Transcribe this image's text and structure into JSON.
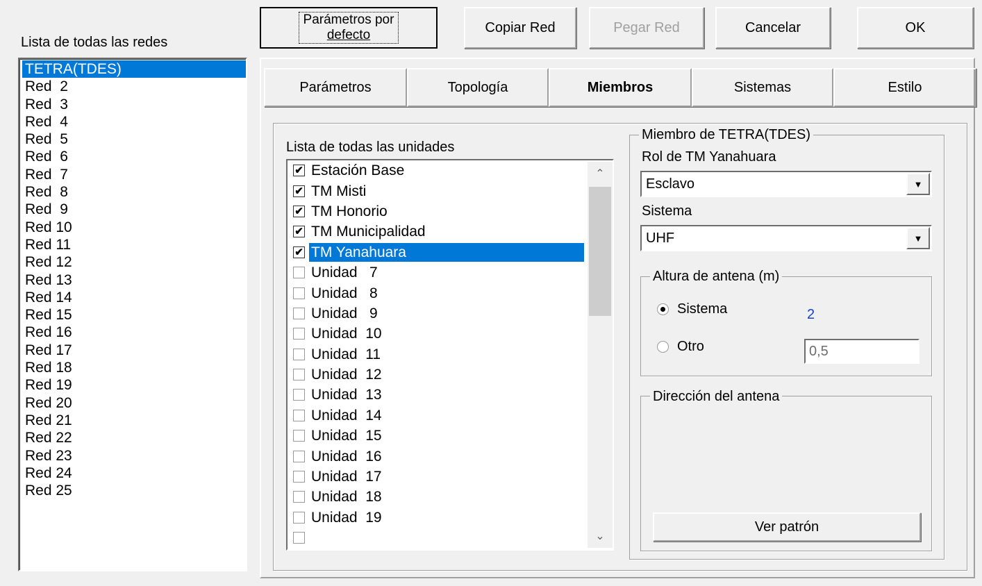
{
  "networks": {
    "label": "Lista de todas las redes",
    "items": [
      "TETRA(TDES)",
      "Red  2",
      "Red  3",
      "Red  4",
      "Red  5",
      "Red  6",
      "Red  7",
      "Red  8",
      "Red  9",
      "Red 10",
      "Red 11",
      "Red 12",
      "Red 13",
      "Red 14",
      "Red 15",
      "Red 16",
      "Red 17",
      "Red 18",
      "Red 19",
      "Red 20",
      "Red 21",
      "Red 22",
      "Red 23",
      "Red 24",
      "Red 25"
    ],
    "selected": "TETRA(TDES)"
  },
  "toolbar": {
    "defaults_line1": "Parámetros por",
    "defaults_line2": "defecto",
    "copy": "Copiar Red",
    "paste": "Pegar Red",
    "cancel": "Cancelar",
    "ok": "OK"
  },
  "tabs": [
    {
      "label": "Parámetros"
    },
    {
      "label": "Topología"
    },
    {
      "label": "Miembros"
    },
    {
      "label": "Sistemas"
    },
    {
      "label": "Estilo"
    }
  ],
  "active_tab": "Miembros",
  "units": {
    "label": "Lista de todas las unidades",
    "items": [
      {
        "name": "Estación Base",
        "checked": true
      },
      {
        "name": "TM Misti",
        "checked": true
      },
      {
        "name": "TM Honorio",
        "checked": true
      },
      {
        "name": "TM Municipalidad",
        "checked": true
      },
      {
        "name": "TM Yanahuara",
        "checked": true,
        "selected": true
      },
      {
        "name": "Unidad   7",
        "checked": false
      },
      {
        "name": "Unidad   8",
        "checked": false
      },
      {
        "name": "Unidad   9",
        "checked": false
      },
      {
        "name": "Unidad  10",
        "checked": false
      },
      {
        "name": "Unidad  11",
        "checked": false
      },
      {
        "name": "Unidad  12",
        "checked": false
      },
      {
        "name": "Unidad  13",
        "checked": false
      },
      {
        "name": "Unidad  14",
        "checked": false
      },
      {
        "name": "Unidad  15",
        "checked": false
      },
      {
        "name": "Unidad  16",
        "checked": false
      },
      {
        "name": "Unidad  17",
        "checked": false
      },
      {
        "name": "Unidad  18",
        "checked": false
      },
      {
        "name": "Unidad  19",
        "checked": false
      },
      {
        "name": "",
        "checked": false
      }
    ],
    "scroll_up_icon": "chevron-up-icon",
    "scroll_down_icon": "chevron-down-icon"
  },
  "member": {
    "group_title": "Miembro de TETRA(TDES)",
    "role_label": "Rol de TM Yanahuara",
    "role_value": "Esclavo",
    "system_label": "Sistema",
    "system_value": "UHF",
    "antenna_height": {
      "group_title": "Altura de antena (m)",
      "system_option": "Sistema",
      "system_value": "2",
      "other_option": "Otro",
      "other_value": "0,5",
      "selected": "Sistema"
    },
    "antenna_direction": {
      "group_title": "Dirección del antena",
      "view_pattern": "Ver patrón"
    }
  },
  "colors": {
    "selection": "#0078d7",
    "value_blue": "#1a3fcf",
    "background": "#f0f0f0"
  }
}
